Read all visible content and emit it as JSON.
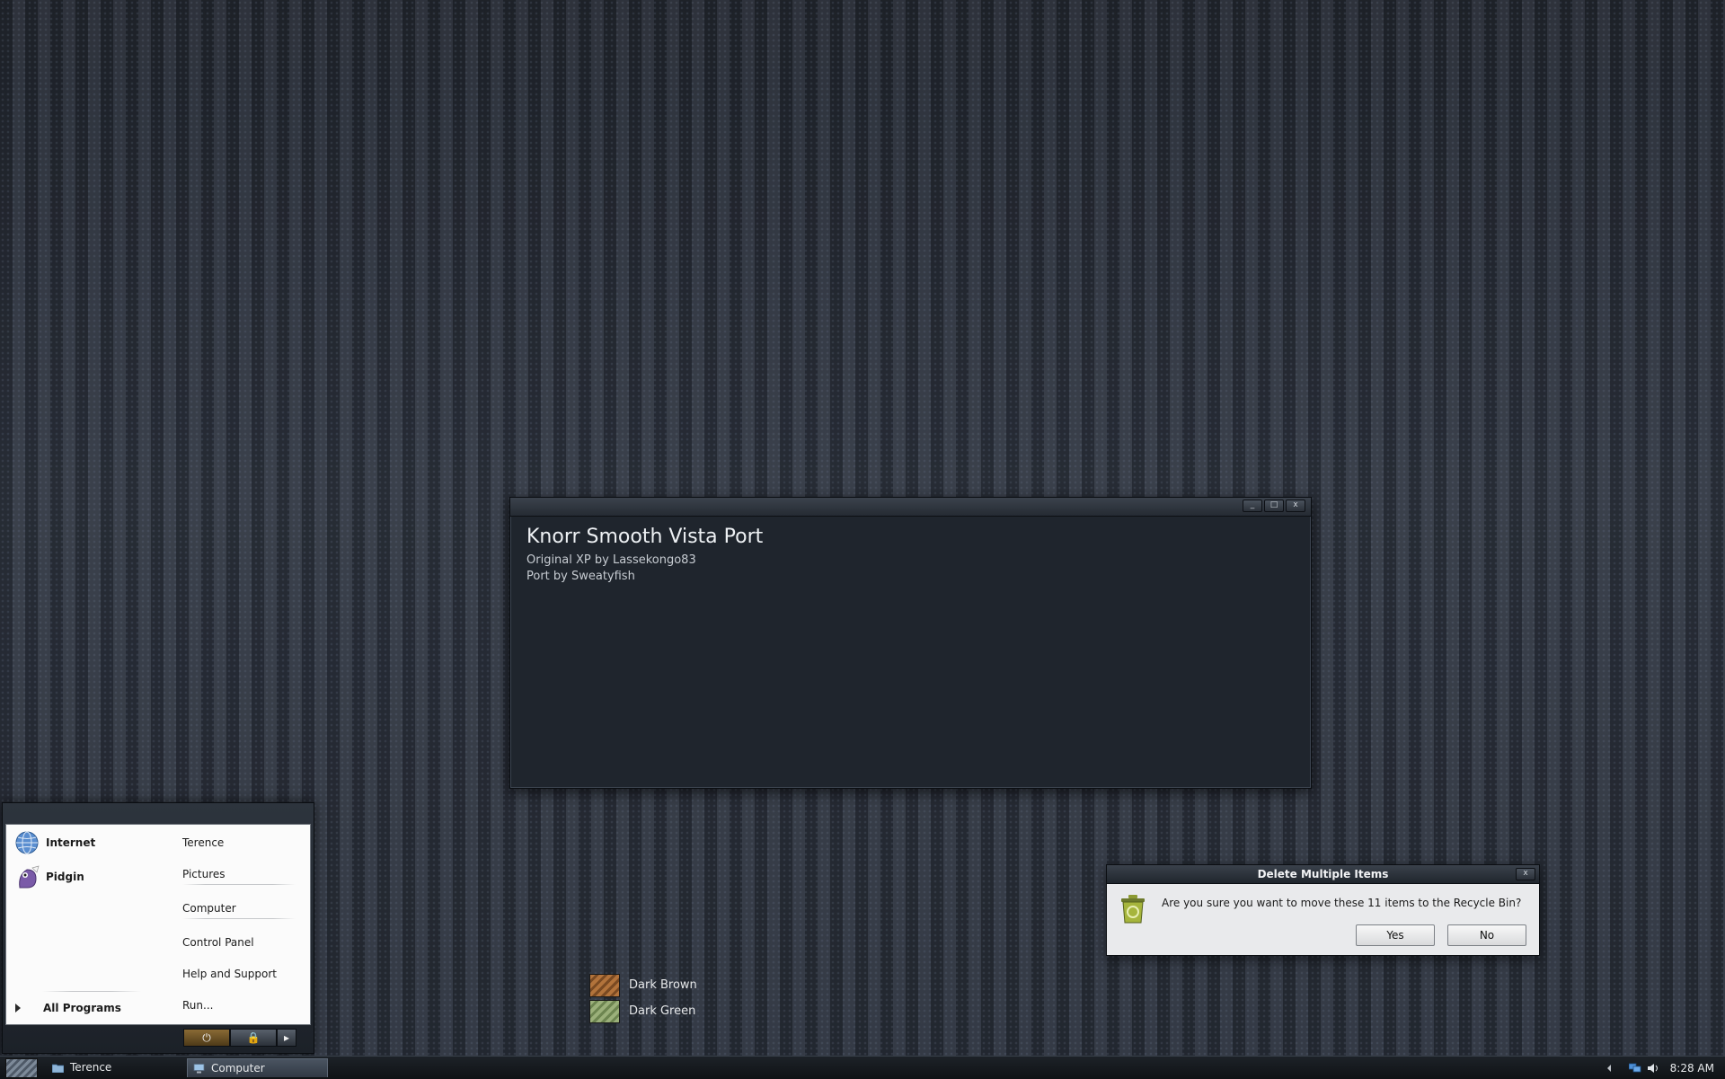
{
  "main_window": {
    "title": "Knorr Smooth Vista Port",
    "line1": "Original XP by Lassekongo83",
    "line2": "Port by Sweatyfish",
    "buttons": {
      "minimize": "_",
      "maximize": "□",
      "close": "x"
    }
  },
  "swatches": [
    {
      "label": "Dark Brown",
      "color": "#b2733b"
    },
    {
      "label": "Dark Green",
      "color": "#9bb07a"
    }
  ],
  "dialog": {
    "title": "Delete Multiple Items",
    "message": "Are you sure you want to move these 11 items to the Recycle Bin?",
    "yes_label": "Yes",
    "no_label": "No",
    "close_label": "x",
    "icon": "recycle-bin-icon"
  },
  "start_menu": {
    "pinned": [
      {
        "label": "Internet",
        "icon": "internet-globe-icon"
      },
      {
        "label": "Pidgin",
        "icon": "pidgin-icon"
      }
    ],
    "all_programs": "All Programs",
    "places": {
      "user": "Terence",
      "pictures": "Pictures",
      "computer": "Computer",
      "control_panel": "Control Panel",
      "help": "Help and Support",
      "run": "Run..."
    },
    "power": {
      "power_icon": "⏻",
      "lock_icon": "🔒",
      "arrow_icon": "▸"
    }
  },
  "taskbar": {
    "tasks": [
      {
        "label": "Terence",
        "icon": "folder-icon",
        "active": false
      },
      {
        "label": "Computer",
        "icon": "computer-icon",
        "active": true
      }
    ],
    "clock": "8:28 AM"
  }
}
